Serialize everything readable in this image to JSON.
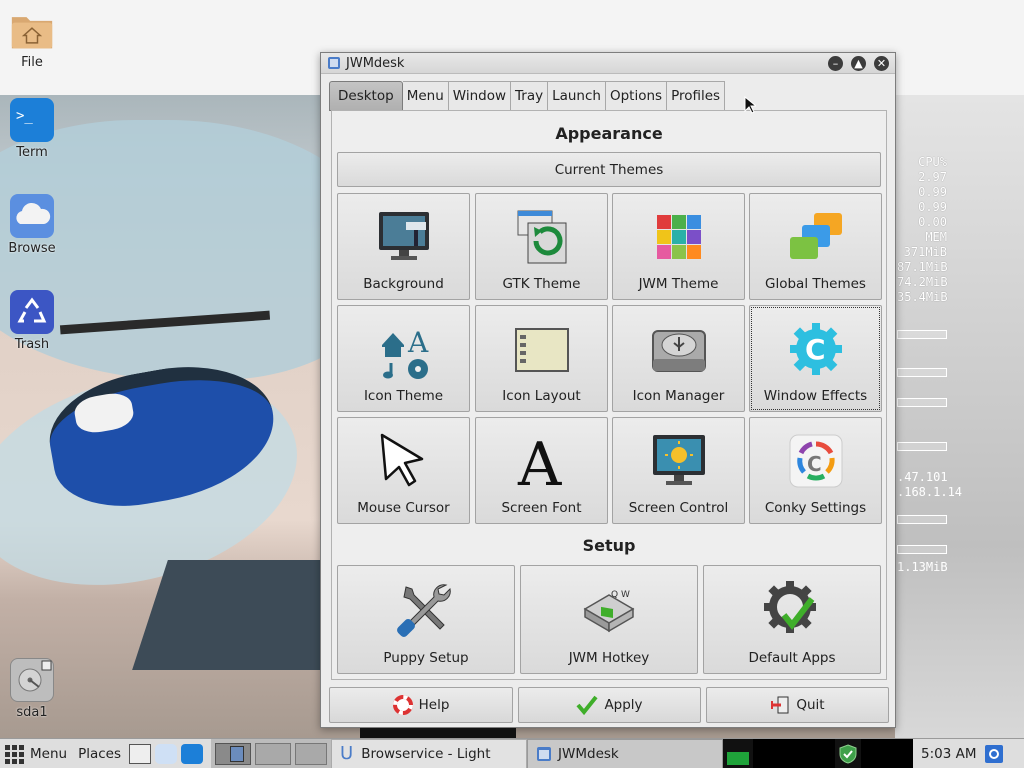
{
  "desktop": {
    "icons": [
      {
        "label": "File",
        "icon": "folder-home-icon"
      },
      {
        "label": "Term",
        "icon": "terminal-icon"
      },
      {
        "label": "Browse",
        "icon": "cloud-icon"
      },
      {
        "label": "Trash",
        "icon": "recycle-icon"
      },
      {
        "label": "sda1",
        "icon": "harddisk-icon"
      }
    ],
    "conky": [
      "CPU%",
      "2.97",
      "0.99",
      "0.99",
      "0.00",
      "MEM",
      "371MiB",
      "87.1MiB",
      "74.2MiB",
      "35.4MiB",
      ".47.101",
      ".168.1.14",
      "1.13MiB"
    ]
  },
  "window": {
    "title": "JWMdesk",
    "tabs": [
      "Desktop",
      "Menu",
      "Window",
      "Tray",
      "Launch",
      "Options",
      "Profiles"
    ],
    "active_tab": "Desktop",
    "appearance": {
      "heading": "Appearance",
      "current_themes": "Current Themes",
      "items": [
        "Background",
        "GTK Theme",
        "JWM Theme",
        "Global Themes",
        "Icon Theme",
        "Icon Layout",
        "Icon Manager",
        "Window Effects",
        "Mouse Cursor",
        "Screen Font",
        "Screen Control",
        "Conky Settings"
      ]
    },
    "setup": {
      "heading": "Setup",
      "items": [
        "Puppy Setup",
        "JWM Hotkey",
        "Default Apps"
      ]
    },
    "buttons": {
      "help": "Help",
      "apply": "Apply",
      "quit": "Quit"
    }
  },
  "taskbar": {
    "menu": "Menu",
    "places": "Places",
    "tasks": [
      "Browservice - Light",
      "JWMdesk"
    ],
    "clock": "5:03 AM"
  },
  "colors": {
    "accent_green": "#3fae2a",
    "title_bg": "#dcdcdc",
    "shield": "#3fa04a"
  }
}
